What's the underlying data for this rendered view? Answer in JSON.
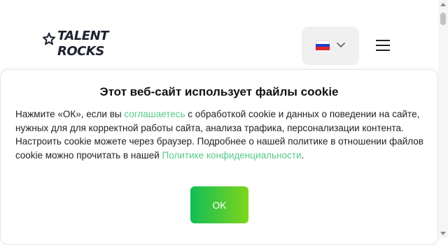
{
  "header": {
    "logo_text_line1": "TALENT",
    "logo_text_line2": "ROCKS",
    "language_flag": "flag-ru",
    "flag_colors": [
      "#ffffff",
      "#1f3fcf",
      "#e0262b"
    ]
  },
  "cookie_banner": {
    "title": "Этот веб-сайт использует файлы cookie",
    "text_part1": "Нажмите «ОК», если вы ",
    "link_agree": "соглашаетесь",
    "text_part2": " с обработкой cookie и данных о поведении на сайте, нужных для для корректной работы сайта, анализа трафика, персонализации контента. Настроить cookie можете через браузер. Подробнее о нашей политике в отношении файлов cookie можно прочитать в нашей ",
    "link_policy": "Политике конфиденциальности",
    "text_part3": ".",
    "ok_label": "OK",
    "accent_color": "#57c98a"
  }
}
